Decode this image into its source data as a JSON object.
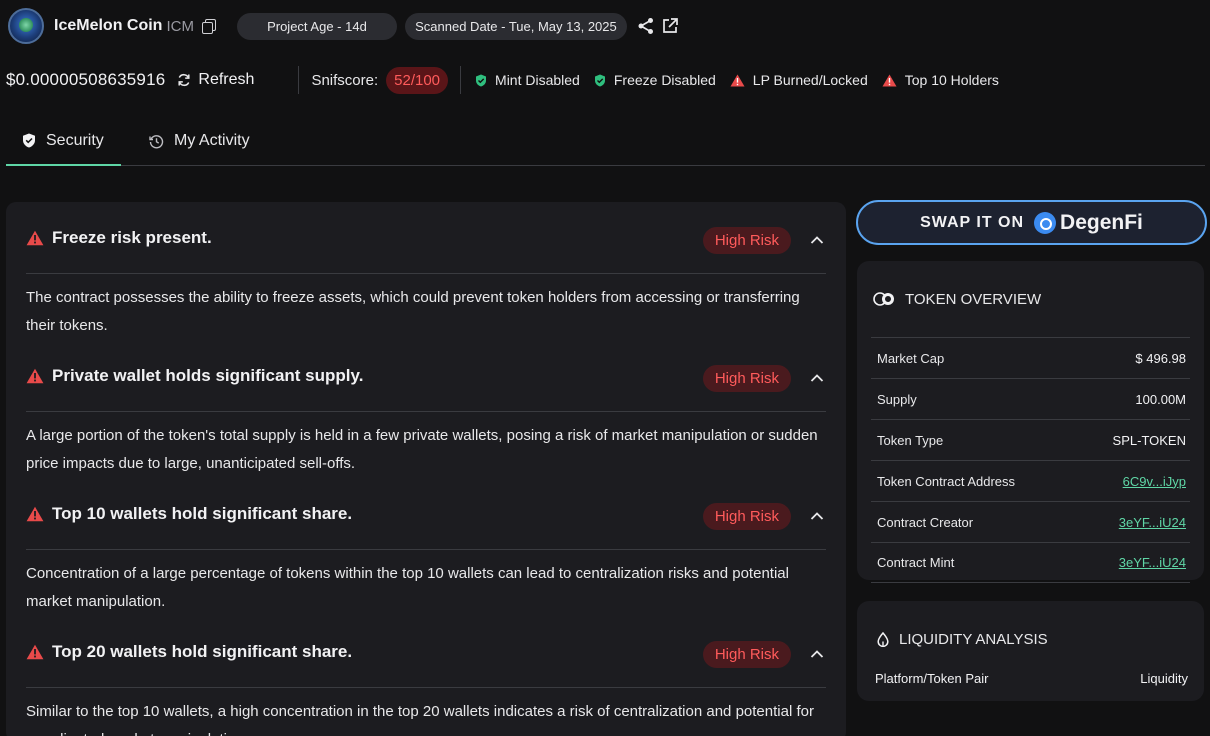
{
  "header": {
    "coin_name": "IceMelon Coin",
    "coin_symbol": "ICM",
    "project_age": "Project Age - 14d",
    "scanned_date": "Scanned Date - Tue, May 13, 2025"
  },
  "stats": {
    "price": "$0.00000508635916",
    "refresh_label": "Refresh",
    "snifscore_label": "Snifscore:",
    "snifscore_value": "52/100",
    "flags": [
      {
        "label": "Mint Disabled",
        "status": "ok"
      },
      {
        "label": "Freeze Disabled",
        "status": "ok"
      },
      {
        "label": "LP Burned/Locked",
        "status": "warn"
      },
      {
        "label": "Top 10 Holders",
        "status": "warn"
      }
    ]
  },
  "tabs": [
    {
      "label": "Security",
      "active": true
    },
    {
      "label": "My Activity",
      "active": false
    }
  ],
  "risks": [
    {
      "title": "Freeze risk present.",
      "badge": "High Risk",
      "description": "The contract possesses the ability to freeze assets, which could prevent token holders from accessing or transferring their tokens."
    },
    {
      "title": "Private wallet holds significant supply.",
      "badge": "High Risk",
      "description": "A large portion of the token's total supply is held in a few private wallets, posing a risk of market manipulation or sudden price impacts due to large, unanticipated sell-offs."
    },
    {
      "title": "Top 10 wallets hold significant share.",
      "badge": "High Risk",
      "description": "Concentration of a large percentage of tokens within the top 10 wallets can lead to centralization risks and potential market manipulation."
    },
    {
      "title": "Top 20 wallets hold significant share.",
      "badge": "High Risk",
      "description": "Similar to the top 10 wallets, a high concentration in the top 20 wallets indicates a risk of centralization and potential for coordinated market manipulation."
    }
  ],
  "swap": {
    "label": "SWAP IT ON",
    "brand": "DegenFi"
  },
  "overview": {
    "title": "TOKEN OVERVIEW",
    "rows": [
      {
        "label": "Market Cap",
        "value": "$ 496.98",
        "link": false
      },
      {
        "label": "Supply",
        "value": "100.00M",
        "link": false
      },
      {
        "label": "Token Type",
        "value": "SPL-TOKEN",
        "link": false
      },
      {
        "label": "Token Contract Address",
        "value": "6C9v...iJyp",
        "link": true
      },
      {
        "label": "Contract Creator",
        "value": "3eYF...iU24",
        "link": true
      },
      {
        "label": "Contract Mint",
        "value": "3eYF...iU24",
        "link": true
      }
    ]
  },
  "liquidity": {
    "title": "LIQUIDITY ANALYSIS",
    "col_pair": "Platform/Token Pair",
    "col_liquidity": "Liquidity"
  },
  "colors": {
    "accent": "#5fd6a6",
    "danger": "#ff5b5b",
    "panel": "#1c1c20",
    "background": "#111112"
  }
}
